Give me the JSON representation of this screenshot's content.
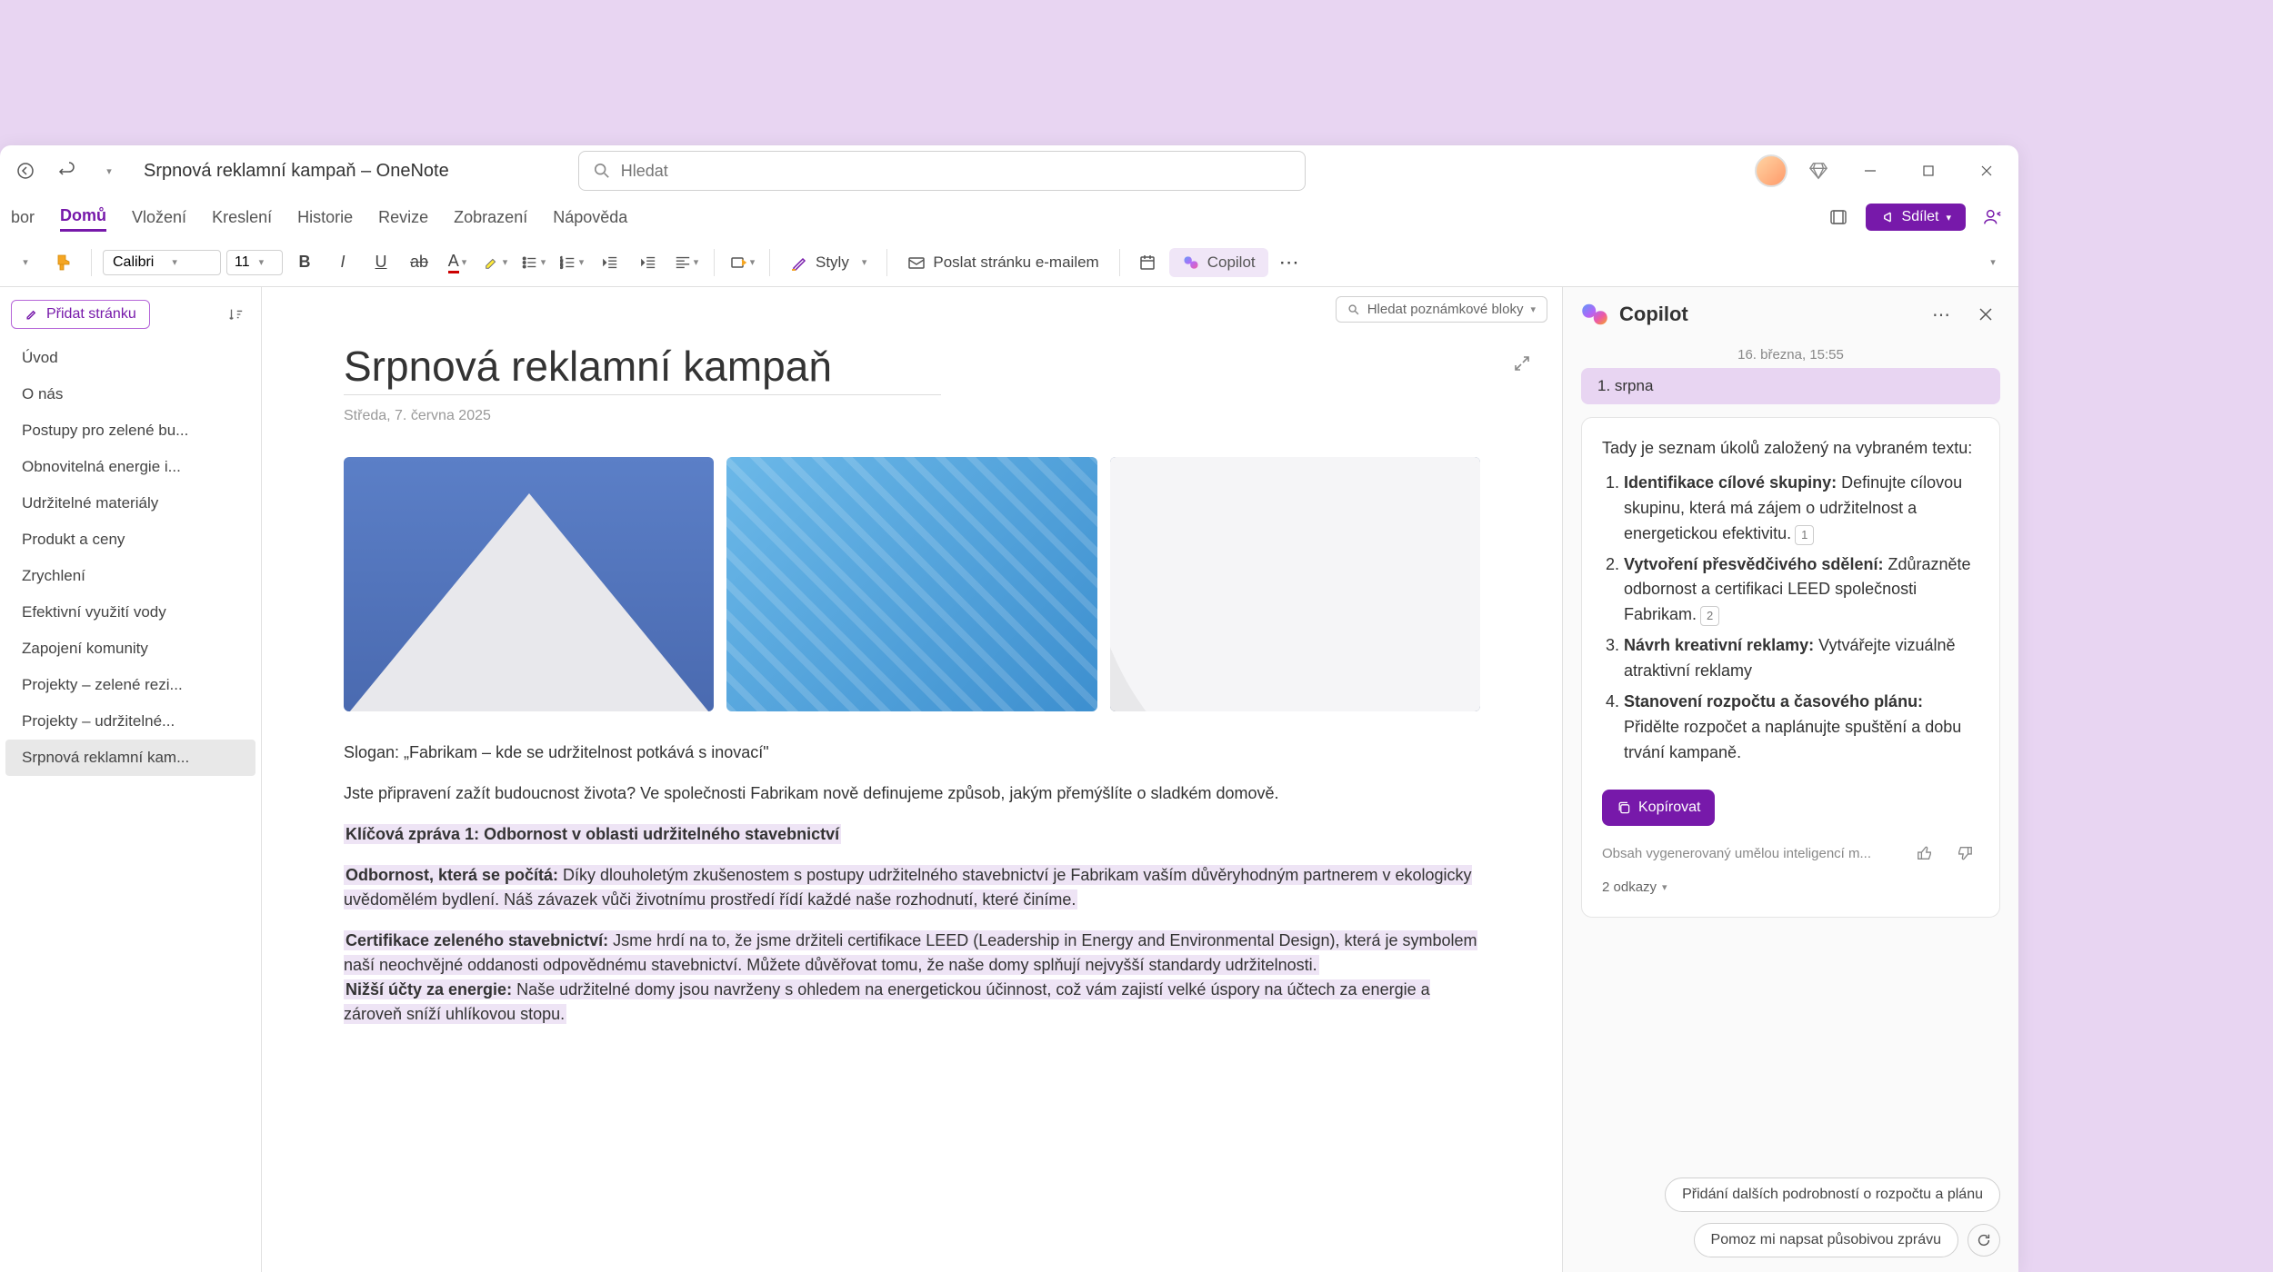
{
  "titlebar": {
    "title": "Srpnová reklamní kampaň – OneNote",
    "search_placeholder": "Hledat"
  },
  "menubar": {
    "items": [
      "bor",
      "Domů",
      "Vložení",
      "Kreslení",
      "Historie",
      "Revize",
      "Zobrazení",
      "Nápověda"
    ],
    "active_index": 1,
    "share_label": "Sdílet"
  },
  "ribbon": {
    "font": "Calibri",
    "size": "11",
    "styles_label": "Styly",
    "email_label": "Poslat stránku e-mailem",
    "copilot_label": "Copilot"
  },
  "sidebar": {
    "add_page_label": "Přidat stránku",
    "pages": [
      "Úvod",
      "O nás",
      "Postupy pro zelené bu...",
      "Obnovitelná energie i...",
      "Udržitelné materiály",
      "Produkt a ceny",
      "Zrychlení",
      "Efektivní využití vody",
      "Zapojení komunity",
      "Projekty – zelené rezi...",
      "Projekty – udržitelné...",
      "Srpnová reklamní kam..."
    ],
    "active_index": 11
  },
  "notebook_search": "Hledat poznámkové bloky",
  "page": {
    "title": "Srpnová reklamní kampaň",
    "date": "Středa, 7. června 2025",
    "slogan": "Slogan: „Fabrikam – kde se udržitelnost potkává s inovací\"",
    "intro": "Jste připravení zažít budoucnost života? Ve společnosti Fabrikam nově definujeme způsob, jakým přemýšlíte o sladkém domově.",
    "key_msg_heading": "Klíčová zpráva 1: Odbornost v oblasti udržitelného stavebnictví",
    "p1_bold": "Odbornost, která se počítá:",
    "p1_text": " Díky dlouholetým zkušenostem s postupy udržitelného stavebnictví je Fabrikam vaším důvěryhodným partnerem v ekologicky uvědomělém bydlení. Náš závazek vůči životnímu prostředí řídí každé naše rozhodnutí, které činíme.",
    "p2_bold": "Certifikace zeleného stavebnictví:",
    "p2_text": " Jsme hrdí na to, že jsme držiteli certifikace LEED (Leadership in Energy and Environmental Design), která je symbolem naší neochvějné oddanosti odpovědnému stavebnictví. Můžete důvěřovat tomu, že naše domy splňují nejvyšší standardy udržitelnosti.",
    "p3_bold": "Nižší účty za energie:",
    "p3_text": " Naše udržitelné domy jsou navrženy s ohledem na energetickou účinnost, což vám zajistí velké úspory na účtech za energie a zároveň sníží uhlíkovou stopu."
  },
  "copilot": {
    "title": "Copilot",
    "date": "16. března, 15:55",
    "chip": "1. srpna",
    "intro": "Tady je seznam úkolů založený na vybraném textu:",
    "tasks": [
      {
        "bold": "Identifikace cílové skupiny:",
        "text": " Definujte cílovou skupinu, která má zájem o udržitelnost a energetickou efektivitu.",
        "ref": "1"
      },
      {
        "bold": "Vytvoření přesvědčivého sdělení:",
        "text": " Zdůrazněte odbornost a certifikaci LEED společnosti Fabrikam.",
        "ref": "2"
      },
      {
        "bold": "Návrh kreativní reklamy:",
        "text": " Vytvářejte vizuálně atraktivní reklamy",
        "ref": ""
      },
      {
        "bold": "Stanovení rozpočtu a časového plánu:",
        "text": " Přidělte rozpočet a naplánujte spuštění a dobu trvání kampaně.",
        "ref": ""
      }
    ],
    "copy_label": "Kopírovat",
    "ai_disclaimer": "Obsah vygenerovaný umělou inteligencí m...",
    "refs_label": "2 odkazy",
    "suggestion1": "Přidání dalších podrobností o rozpočtu a plánu",
    "suggestion2": "Pomoz mi napsat působivou zprávu"
  }
}
